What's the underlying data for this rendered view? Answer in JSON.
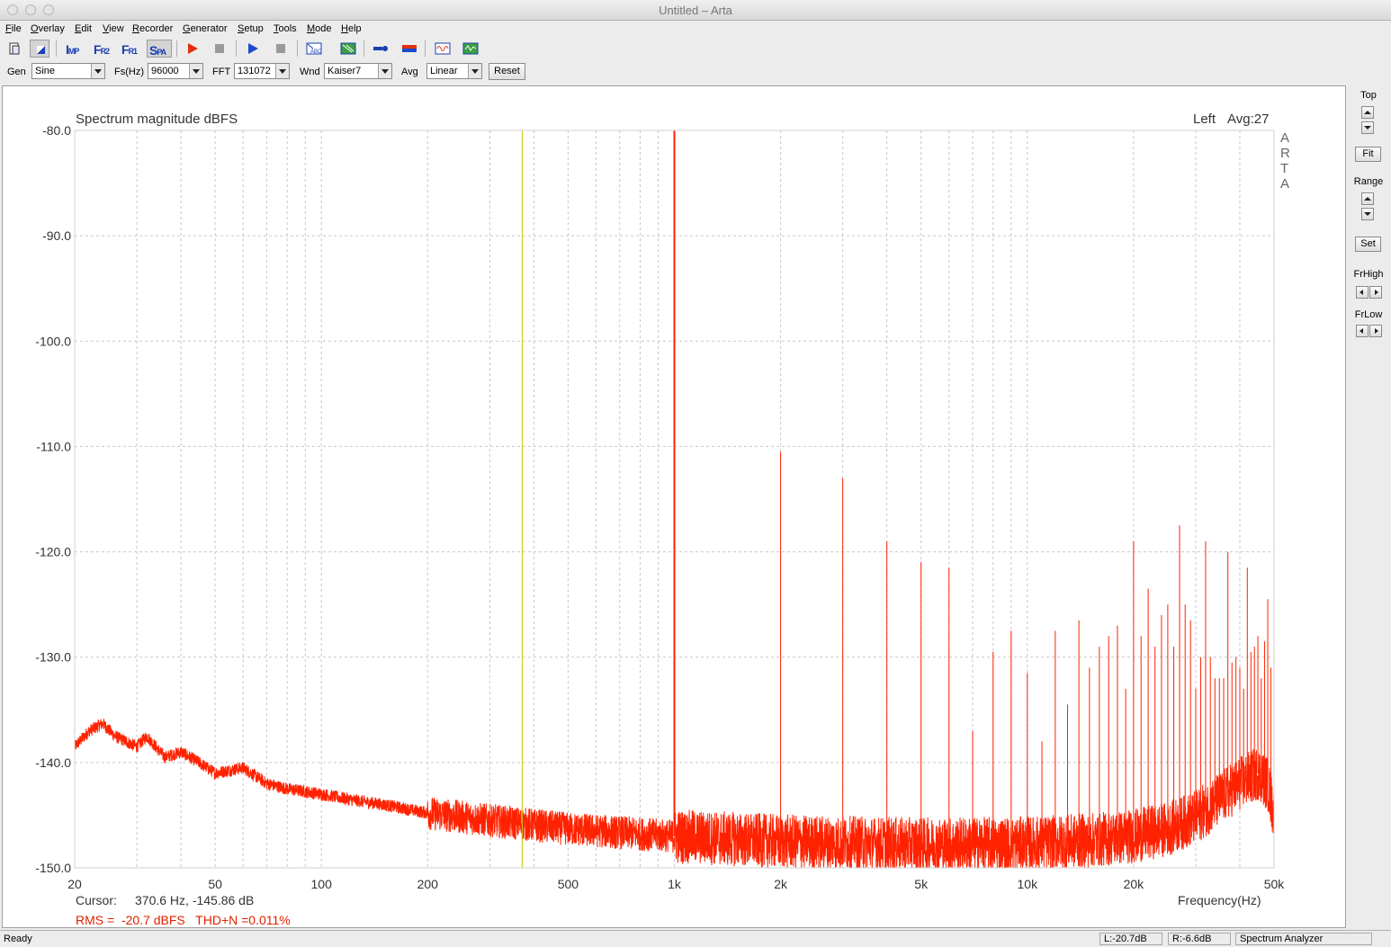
{
  "window": {
    "title": "Untitled – Arta"
  },
  "menu": [
    {
      "label": "File",
      "u": "F",
      "rest": "ile"
    },
    {
      "label": "Overlay",
      "u": "O",
      "rest": "verlay"
    },
    {
      "label": "Edit",
      "u": "E",
      "rest": "dit"
    },
    {
      "label": "View",
      "u": "V",
      "rest": "iew"
    },
    {
      "label": "Recorder",
      "u": "R",
      "rest": "ecorder"
    },
    {
      "label": "Generator",
      "u": "G",
      "rest": "enerator"
    },
    {
      "label": "Setup",
      "u": "S",
      "rest": "etup"
    },
    {
      "label": "Tools",
      "u": "T",
      "rest": "ools"
    },
    {
      "label": "Mode",
      "u": "M",
      "rest": "ode"
    },
    {
      "label": "Help",
      "u": "H",
      "rest": "elp"
    }
  ],
  "toolbar": {
    "imp": {
      "big": "I",
      "small": "MP"
    },
    "fr2": {
      "big": "F",
      "small": "R2"
    },
    "fr1": {
      "big": "F",
      "small": "R1"
    },
    "spa": {
      "big": "S",
      "small": "PA"
    }
  },
  "controls": {
    "gen_label": "Gen",
    "gen_value": "Sine",
    "fs_label": "Fs(Hz)",
    "fs_value": "96000",
    "fft_label": "FFT",
    "fft_value": "131072",
    "wnd_label": "Wnd",
    "wnd_value": "Kaiser7",
    "avg_label": "Avg",
    "avg_value": "Linear",
    "reset_label": "Reset"
  },
  "right_panel": {
    "top_label": "Top",
    "fit_label": "Fit",
    "range_label": "Range",
    "set_label": "Set",
    "frhigh_label": "FrHigh",
    "frlow_label": "FrLow"
  },
  "plot": {
    "title": "Spectrum magnitude dBFS",
    "channel": "Left",
    "avg_text": "Avg:27",
    "watermark": [
      "A",
      "R",
      "T",
      "A"
    ],
    "cursor_label": "Cursor:",
    "cursor_value": "370.6 Hz, -145.86 dB",
    "rms_text": "RMS =  -20.7 dBFS   THD+N =0.011%",
    "xlabel": "Frequency(Hz)"
  },
  "colors": {
    "trace": "#ff2200",
    "cursor": "#c8c800",
    "grid": "#c8c8c8"
  },
  "chart_data": {
    "type": "line",
    "title": "Spectrum magnitude dBFS",
    "xlabel": "Frequency(Hz)",
    "ylabel": "",
    "xscale": "log",
    "xlim": [
      20,
      50000
    ],
    "ylim": [
      -150,
      -80
    ],
    "grid": true,
    "y_ticks": [
      "-80.0",
      "-90.0",
      "-100.0",
      "-110.0",
      "-120.0",
      "-130.0",
      "-140.0",
      "-150.0"
    ],
    "x_ticks": [
      {
        "v": 20,
        "label": "20"
      },
      {
        "v": 50,
        "label": "50"
      },
      {
        "v": 100,
        "label": "100"
      },
      {
        "v": 200,
        "label": "200"
      },
      {
        "v": 500,
        "label": "500"
      },
      {
        "v": 1000,
        "label": "1k"
      },
      {
        "v": 2000,
        "label": "2k"
      },
      {
        "v": 5000,
        "label": "5k"
      },
      {
        "v": 10000,
        "label": "10k"
      },
      {
        "v": 20000,
        "label": "20k"
      },
      {
        "v": 50000,
        "label": "50k"
      }
    ],
    "cursor_hz": 370.6,
    "noise_floor": [
      [
        20,
        -138.5
      ],
      [
        22,
        -137
      ],
      [
        24,
        -136.3
      ],
      [
        26,
        -137.5
      ],
      [
        30,
        -138.5
      ],
      [
        32,
        -137.5
      ],
      [
        36,
        -139.5
      ],
      [
        40,
        -139
      ],
      [
        45,
        -140
      ],
      [
        50,
        -141
      ],
      [
        60,
        -140.5
      ],
      [
        70,
        -142
      ],
      [
        80,
        -142.5
      ],
      [
        100,
        -143
      ],
      [
        120,
        -143.5
      ],
      [
        150,
        -144
      ],
      [
        200,
        -144.8
      ],
      [
        300,
        -145.5
      ],
      [
        500,
        -146.3
      ],
      [
        1000,
        -147
      ],
      [
        2000,
        -147.5
      ],
      [
        5000,
        -147.8
      ],
      [
        10000,
        -147.7
      ],
      [
        15000,
        -147.4
      ],
      [
        20000,
        -147
      ],
      [
        25000,
        -146.3
      ],
      [
        30000,
        -145.2
      ],
      [
        35000,
        -143.5
      ],
      [
        40000,
        -142
      ],
      [
        45000,
        -141
      ],
      [
        48000,
        -142
      ],
      [
        50000,
        -145
      ]
    ],
    "peaks": [
      [
        1000,
        -80
      ],
      [
        2000,
        -110.5
      ],
      [
        3000,
        -113
      ],
      [
        4000,
        -119
      ],
      [
        5000,
        -121
      ],
      [
        6000,
        -121.5
      ],
      [
        7000,
        -137
      ],
      [
        8000,
        -129.5
      ],
      [
        9000,
        -127.5
      ],
      [
        10000,
        -131.5
      ],
      [
        11000,
        -138
      ],
      [
        12000,
        -127.5
      ],
      [
        13000,
        -134.5
      ],
      [
        14000,
        -126.5
      ],
      [
        15000,
        -131
      ],
      [
        16000,
        -129
      ],
      [
        17000,
        -128
      ],
      [
        18000,
        -127
      ],
      [
        19000,
        -133
      ],
      [
        20000,
        -119
      ],
      [
        21000,
        -128
      ],
      [
        22000,
        -123.5
      ],
      [
        23000,
        -129
      ],
      [
        24000,
        -126
      ],
      [
        25000,
        -125
      ],
      [
        26000,
        -129
      ],
      [
        27000,
        -117.5
      ],
      [
        28000,
        -125
      ],
      [
        29000,
        -126.5
      ],
      [
        30000,
        -133
      ],
      [
        31000,
        -130
      ],
      [
        32000,
        -119
      ],
      [
        33000,
        -130
      ],
      [
        34000,
        -132
      ],
      [
        35000,
        -132
      ],
      [
        36000,
        -132
      ],
      [
        37000,
        -120
      ],
      [
        38000,
        -130.5
      ],
      [
        39000,
        -130
      ],
      [
        40000,
        -131
      ],
      [
        41000,
        -133
      ],
      [
        42000,
        -121.5
      ],
      [
        43000,
        -129.5
      ],
      [
        44000,
        -129
      ],
      [
        45000,
        -128
      ],
      [
        46000,
        -132
      ],
      [
        47000,
        -128.5
      ],
      [
        48000,
        -124.5
      ],
      [
        49000,
        -131
      ]
    ]
  }
}
